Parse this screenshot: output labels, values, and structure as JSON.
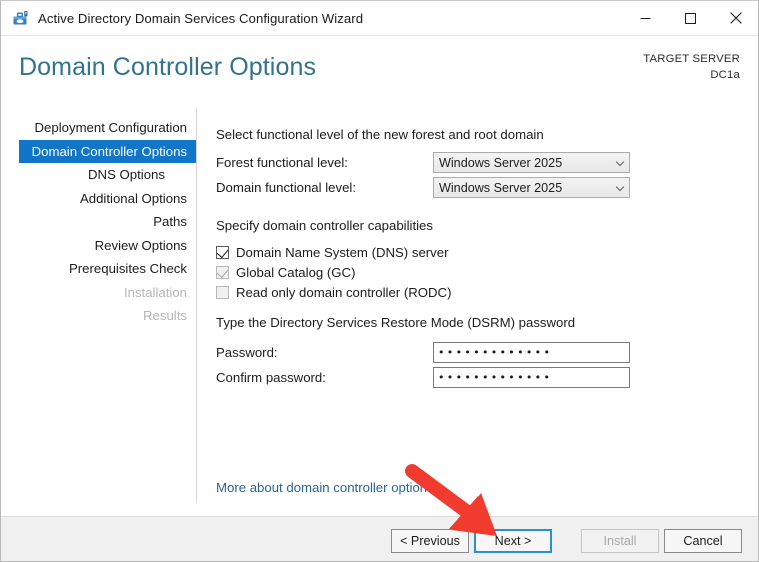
{
  "window": {
    "title": "Active Directory Domain Services Configuration Wizard",
    "app_icon": "server-toolbox-icon",
    "controls": {
      "minimize": "minimize-icon",
      "maximize": "maximize-icon",
      "close": "close-icon"
    }
  },
  "header": {
    "page_title": "Domain Controller Options",
    "target_server_label": "TARGET SERVER",
    "target_server_name": "DC1a",
    "title_color": "#2f7391"
  },
  "sidebar": {
    "items": [
      {
        "label": "Deployment Configuration",
        "state": "normal"
      },
      {
        "label": "Domain Controller Options",
        "state": "selected"
      },
      {
        "label": "DNS Options",
        "state": "sub"
      },
      {
        "label": "Additional Options",
        "state": "normal"
      },
      {
        "label": "Paths",
        "state": "normal"
      },
      {
        "label": "Review Options",
        "state": "normal"
      },
      {
        "label": "Prerequisites Check",
        "state": "normal"
      },
      {
        "label": "Installation",
        "state": "disabled"
      },
      {
        "label": "Results",
        "state": "disabled"
      }
    ],
    "selected_color": "#1276c8"
  },
  "main": {
    "functional_level": {
      "heading": "Select functional level of the new forest and root domain",
      "forest_label": "Forest functional level:",
      "forest_value": "Windows Server 2025",
      "domain_label": "Domain functional level:",
      "domain_value": "Windows Server 2025",
      "chevron_icon": "chevron-down-icon"
    },
    "capabilities": {
      "heading": "Specify domain controller capabilities",
      "options": [
        {
          "label": "Domain Name System (DNS) server",
          "checked": true,
          "enabled": true
        },
        {
          "label": "Global Catalog (GC)",
          "checked": true,
          "enabled": false
        },
        {
          "label": "Read only domain controller (RODC)",
          "checked": false,
          "enabled": false
        }
      ]
    },
    "dsrm": {
      "heading": "Type the Directory Services Restore Mode (DSRM) password",
      "password_label": "Password:",
      "password_value": "•••••••••••••",
      "confirm_label": "Confirm password:",
      "confirm_value": "•••••••••••••"
    },
    "more_link": "More about domain controller options"
  },
  "footer": {
    "previous_label": "< Previous",
    "next_label": "Next >",
    "install_label": "Install",
    "cancel_label": "Cancel"
  },
  "annotation": {
    "type": "red-arrow",
    "color": "#f23b2f",
    "points_to": "next-button"
  }
}
